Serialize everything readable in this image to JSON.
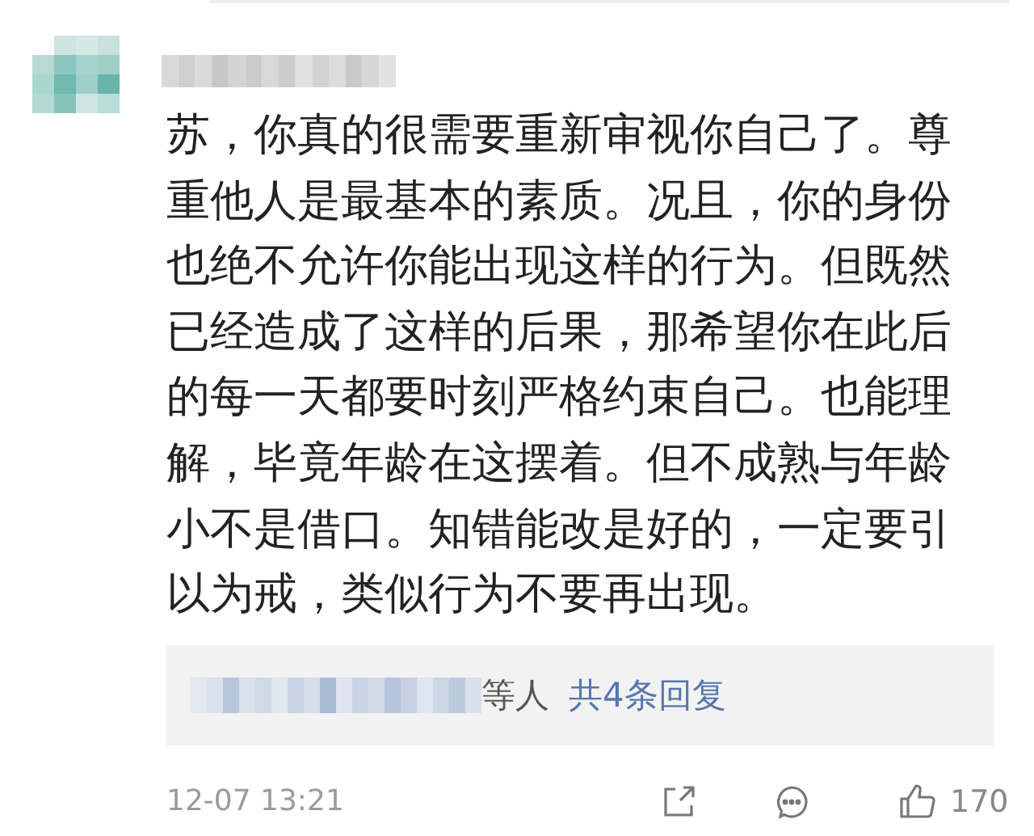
{
  "comment": {
    "lines": [
      "苏，你真的很需要重新审视你自己了。尊",
      "重他人是最基本的素质。况且，你的身份",
      "也绝不允许你能出现这样的行为。但既然",
      "已经造成了这样的后果，那希望你在此后",
      "的每一天都要时刻严格约束自己。也能理",
      "解，毕竟年龄在这摆着。但不成熟与年龄",
      "小不是借口。知错能改是好的，一定要引",
      "以为戒，类似行为不要再出现。"
    ],
    "replies": {
      "suffix": "等人",
      "link": "共4条回复"
    },
    "time": "12-07 13:21",
    "likes": "170"
  }
}
